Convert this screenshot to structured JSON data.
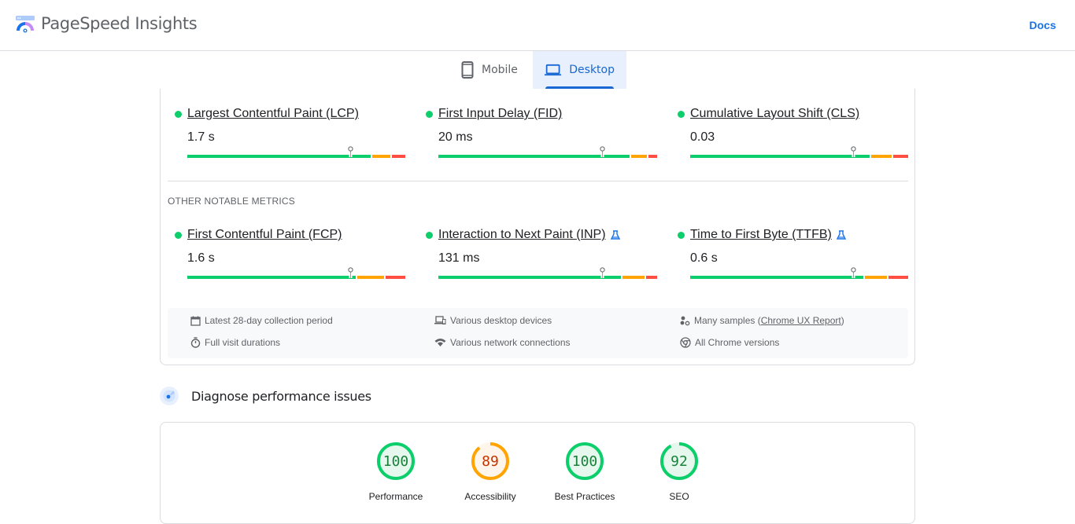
{
  "header": {
    "brand": "PageSpeed Insights",
    "docs_link": "Docs"
  },
  "tabs": [
    {
      "label": "Mobile",
      "active": false
    },
    {
      "label": "Desktop",
      "active": true
    }
  ],
  "core_metrics": [
    {
      "name": "Largest Contentful Paint (LCP)",
      "value": "1.7 s",
      "status": "good",
      "experimental": false,
      "distribution": {
        "good": 0.85,
        "needs_improvement": 0.09,
        "poor": 0.06
      },
      "p75_position": 0.75
    },
    {
      "name": "First Input Delay (FID)",
      "value": "20 ms",
      "status": "good",
      "experimental": false,
      "distribution": {
        "good": 0.88,
        "needs_improvement": 0.08,
        "poor": 0.04
      },
      "p75_position": 0.75
    },
    {
      "name": "Cumulative Layout Shift (CLS)",
      "value": "0.03",
      "status": "good",
      "experimental": false,
      "distribution": {
        "good": 0.83,
        "needs_improvement": 0.1,
        "poor": 0.07
      },
      "p75_position": 0.75
    }
  ],
  "other_metrics_label": "OTHER NOTABLE METRICS",
  "other_metrics": [
    {
      "name": "First Contentful Paint (FCP)",
      "value": "1.6 s",
      "status": "good",
      "experimental": false,
      "distribution": {
        "good": 0.78,
        "needs_improvement": 0.13,
        "poor": 0.09
      },
      "p75_position": 0.75
    },
    {
      "name": "Interaction to Next Paint (INP)",
      "value": "131 ms",
      "status": "good",
      "experimental": true,
      "distribution": {
        "good": 0.84,
        "needs_improvement": 0.11,
        "poor": 0.05
      },
      "p75_position": 0.75
    },
    {
      "name": "Time to First Byte (TTFB)",
      "value": "0.6 s",
      "status": "good",
      "experimental": true,
      "distribution": {
        "good": 0.8,
        "needs_improvement": 0.11,
        "poor": 0.09
      },
      "p75_position": 0.75
    }
  ],
  "info": {
    "collection_period": "Latest 28-day collection period",
    "visit_durations": "Full visit durations",
    "devices": "Various desktop devices",
    "network": "Various network connections",
    "samples_prefix": "Many samples (",
    "samples_link": "Chrome UX Report",
    "samples_suffix": ")",
    "chrome_versions": "All Chrome versions"
  },
  "diagnose": {
    "title": "Diagnose performance issues"
  },
  "scores": [
    {
      "label": "Performance",
      "score": 100,
      "status": "good"
    },
    {
      "label": "Accessibility",
      "score": 89,
      "status": "average"
    },
    {
      "label": "Best Practices",
      "score": 100,
      "status": "good"
    },
    {
      "label": "SEO",
      "score": 92,
      "status": "good"
    }
  ],
  "colors": {
    "good": "#0cce6b",
    "average": "#ffa400",
    "poor": "#ff4e42",
    "good_text": "#188038",
    "average_text": "#c33300",
    "accent": "#1a73e8"
  }
}
